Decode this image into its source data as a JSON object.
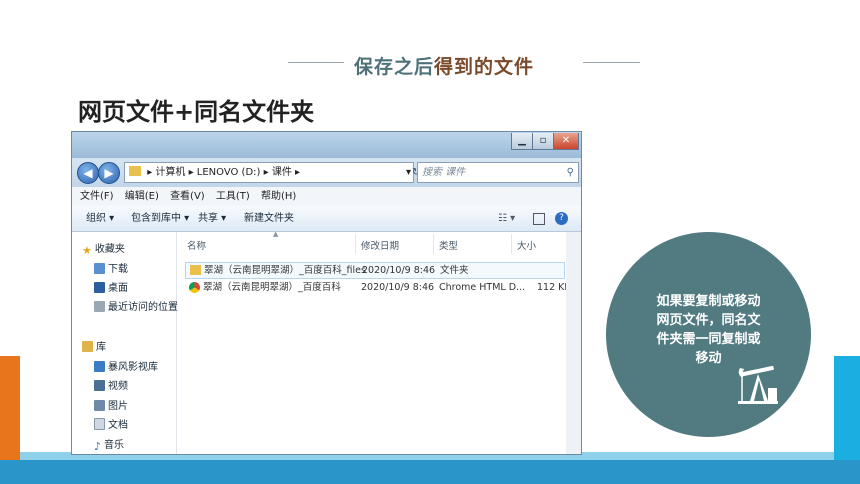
{
  "header": {
    "title_part1": "保存之后",
    "title_part2": "得到的文件",
    "subtitle": "网页文件+同名文件夹"
  },
  "window": {
    "address": {
      "part1": "计算机",
      "part2": "LENOVO (D:)",
      "part3": "课件"
    },
    "search_placeholder": "搜索 课件",
    "menu": [
      "文件(F)",
      "编辑(E)",
      "查看(V)",
      "工具(T)",
      "帮助(H)"
    ],
    "toolbar": {
      "organize": "组织 ▾",
      "include": "包含到库中 ▾",
      "share": "共享 ▾",
      "new_folder": "新建文件夹"
    },
    "nav": {
      "favorites": "收藏夹",
      "downloads": "下载",
      "desktop": "桌面",
      "recent": "最近访问的位置",
      "libraries": "库",
      "storm": "暴风影视库",
      "videos": "视频",
      "pictures": "图片",
      "documents": "文档",
      "music": "音乐"
    },
    "columns": {
      "name": "名称",
      "date": "修改日期",
      "type": "类型",
      "size": "大小"
    },
    "files": [
      {
        "name": "翠湖（云南昆明翠湖）_百度百科_files",
        "date": "2020/10/9 8:46",
        "type": "文件夹",
        "size": ""
      },
      {
        "name": "翠湖（云南昆明翠湖）_百度百科",
        "date": "2020/10/9 8:46",
        "type": "Chrome HTML D...",
        "size": "112 KB"
      }
    ]
  },
  "note": {
    "line1": "如果要复制或移动",
    "line2": "网页文件，同名文",
    "line3": "件夹需一同复制或",
    "line4": "移动"
  }
}
